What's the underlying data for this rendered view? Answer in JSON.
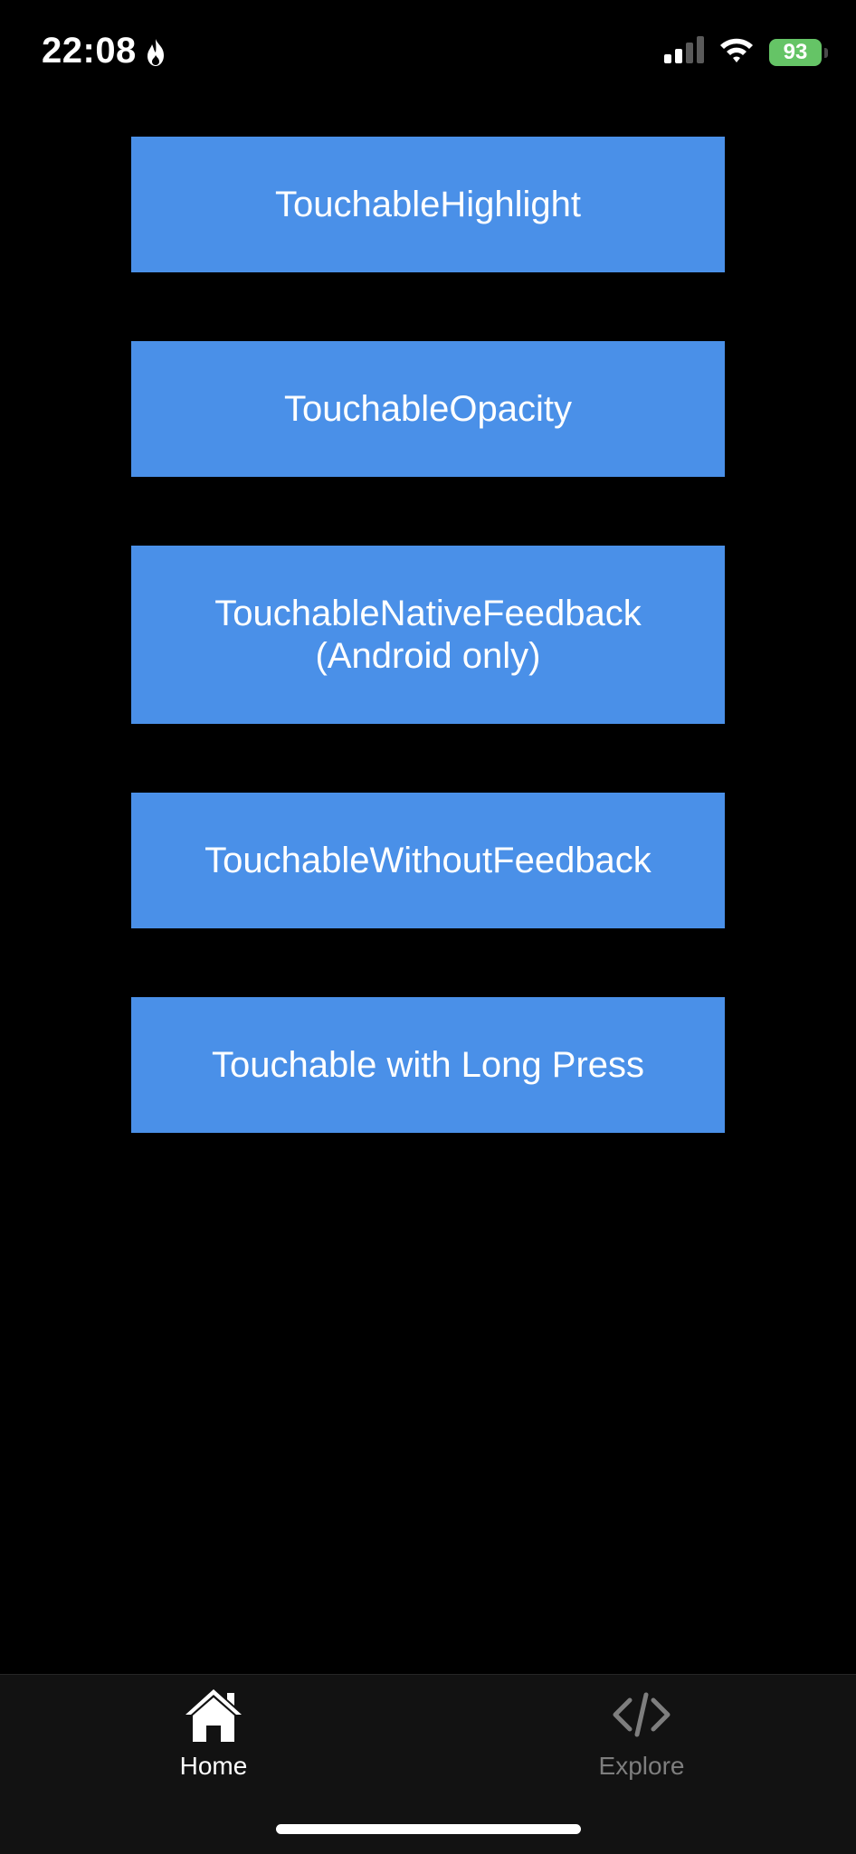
{
  "status_bar": {
    "time": "22:08",
    "battery_level": "93",
    "icons": [
      "flame-icon",
      "signal-icon",
      "wifi-icon",
      "battery-icon"
    ]
  },
  "buttons": [
    {
      "line1": "TouchableHighlight",
      "line2": ""
    },
    {
      "line1": "TouchableOpacity",
      "line2": ""
    },
    {
      "line1": "TouchableNativeFeedback",
      "line2": "(Android only)"
    },
    {
      "line1": "TouchableWithoutFeedback",
      "line2": ""
    },
    {
      "line1": "Touchable with Long Press",
      "line2": ""
    }
  ],
  "tab_bar": {
    "home_label": "Home",
    "explore_label": "Explore",
    "active_tab": "Home"
  },
  "colors": {
    "background": "#000000",
    "button": "#4a90e8",
    "tab_bar": "#121212",
    "battery": "#65c466",
    "tab_active": "#ffffff",
    "tab_inactive": "#7e7e7e"
  }
}
